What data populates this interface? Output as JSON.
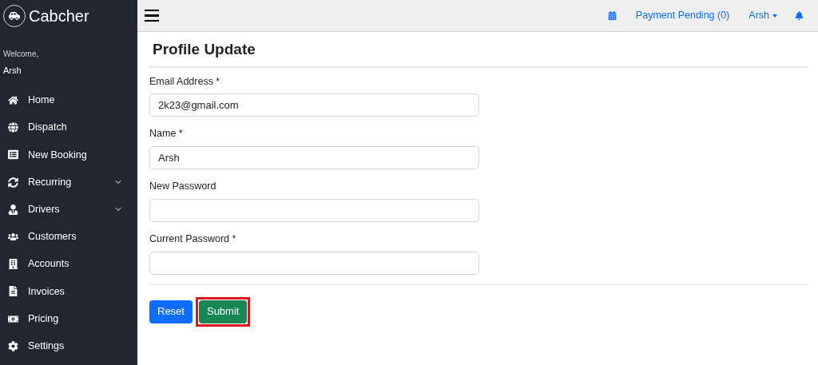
{
  "brand": {
    "name": "Cabcher"
  },
  "welcome": {
    "greeting": "Welcome,",
    "user": "Arsh"
  },
  "sidebar": {
    "items": [
      {
        "label": "Home",
        "kind": "link"
      },
      {
        "label": "Dispatch",
        "kind": "link"
      },
      {
        "label": "New Booking",
        "kind": "link"
      },
      {
        "label": "Recurring",
        "kind": "group",
        "expanded": false
      },
      {
        "label": "Drivers",
        "kind": "group",
        "expanded": false
      },
      {
        "label": "Customers",
        "kind": "link"
      },
      {
        "label": "Accounts",
        "kind": "link"
      },
      {
        "label": "Invoices",
        "kind": "link"
      },
      {
        "label": "Pricing",
        "kind": "link"
      },
      {
        "label": "Settings",
        "kind": "link"
      }
    ]
  },
  "topbar": {
    "payment": "Payment Pending (0)",
    "user": "Arsh"
  },
  "form": {
    "title": "Profile Update",
    "fields": [
      {
        "label": "Email Address *",
        "value": "2k23@gmail.com"
      },
      {
        "label": "Name *",
        "value": "Arsh"
      },
      {
        "label": "New Password"
      },
      {
        "label": "Current Password *"
      }
    ],
    "buttons": [
      {
        "label": "Reset",
        "kind": "secondary",
        "highlighted": false
      },
      {
        "label": "Submit",
        "kind": "primary",
        "highlighted": true
      }
    ]
  }
}
